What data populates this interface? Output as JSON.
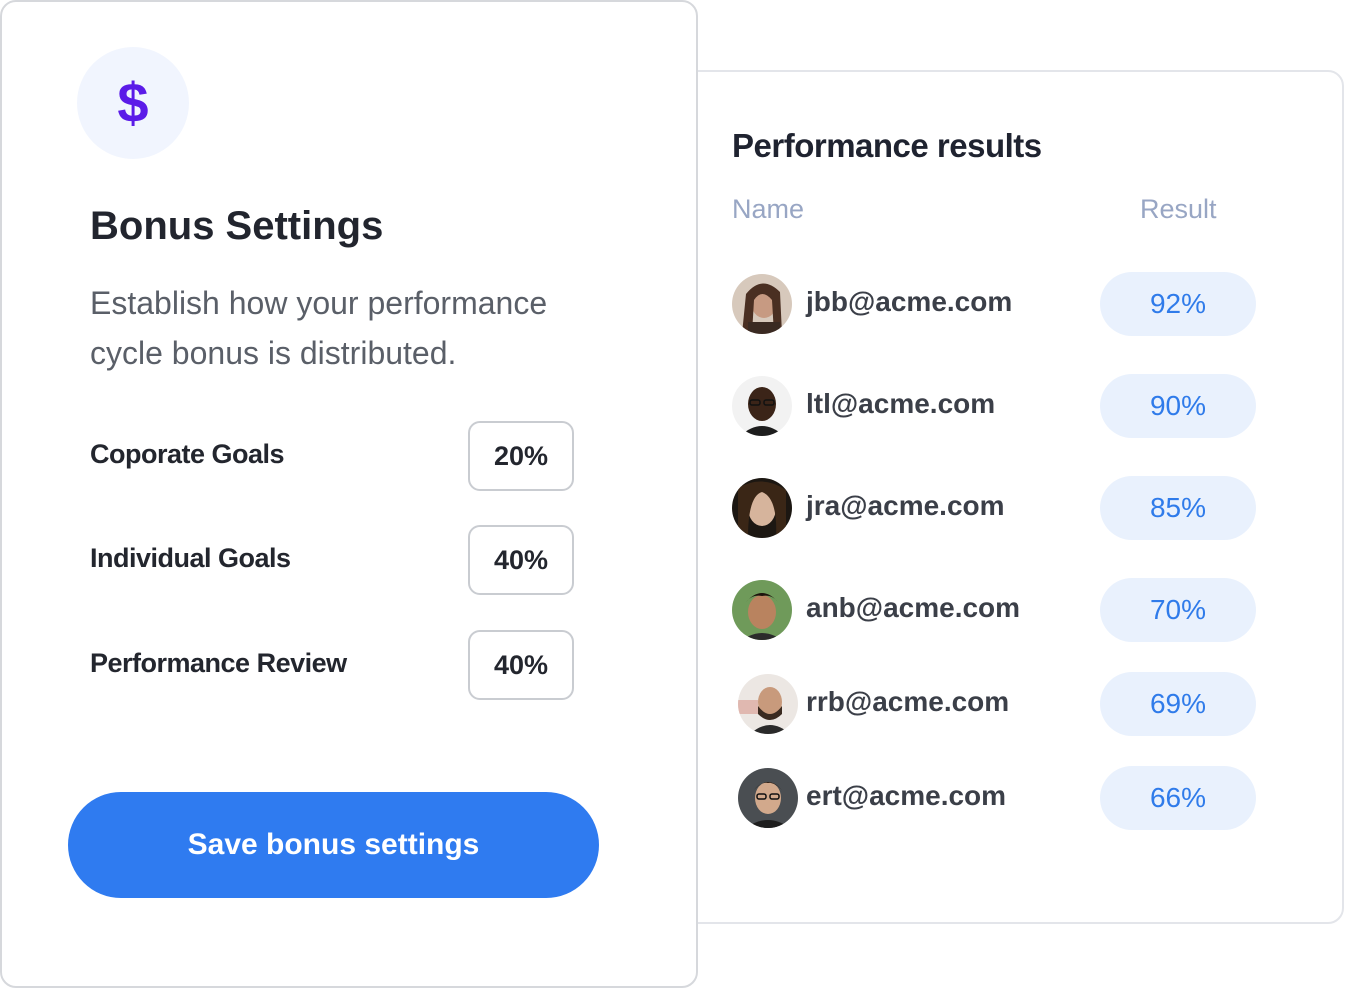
{
  "bonus": {
    "icon": "dollar-icon",
    "icon_glyph": "$",
    "title": "Bonus Settings",
    "description": "Establish how your performance cycle bonus is distributed.",
    "settings": [
      {
        "label": "Coporate Goals",
        "value": "20%"
      },
      {
        "label": "Individual Goals",
        "value": "40%"
      },
      {
        "label": "Performance Review",
        "value": "40%"
      }
    ],
    "save_label": "Save bonus settings"
  },
  "results": {
    "title": "Performance results",
    "col_name": "Name",
    "col_result": "Result",
    "rows": [
      {
        "email": "jbb@acme.com",
        "result": "92%",
        "avatar": "avatar-photo"
      },
      {
        "email": "ltl@acme.com",
        "result": "90%",
        "avatar": "avatar-photo"
      },
      {
        "email": "jra@acme.com",
        "result": "85%",
        "avatar": "avatar-photo"
      },
      {
        "email": "anb@acme.com",
        "result": "70%",
        "avatar": "avatar-photo"
      },
      {
        "email": "rrb@acme.com",
        "result": "69%",
        "avatar": "avatar-photo"
      },
      {
        "email": "ert@acme.com",
        "result": "66%",
        "avatar": "avatar-photo"
      }
    ]
  },
  "colors": {
    "accent": "#2f7bf0",
    "dollar": "#5b1be8",
    "pill_bg": "#e9f1fd",
    "pill_text": "#2f7bea"
  }
}
